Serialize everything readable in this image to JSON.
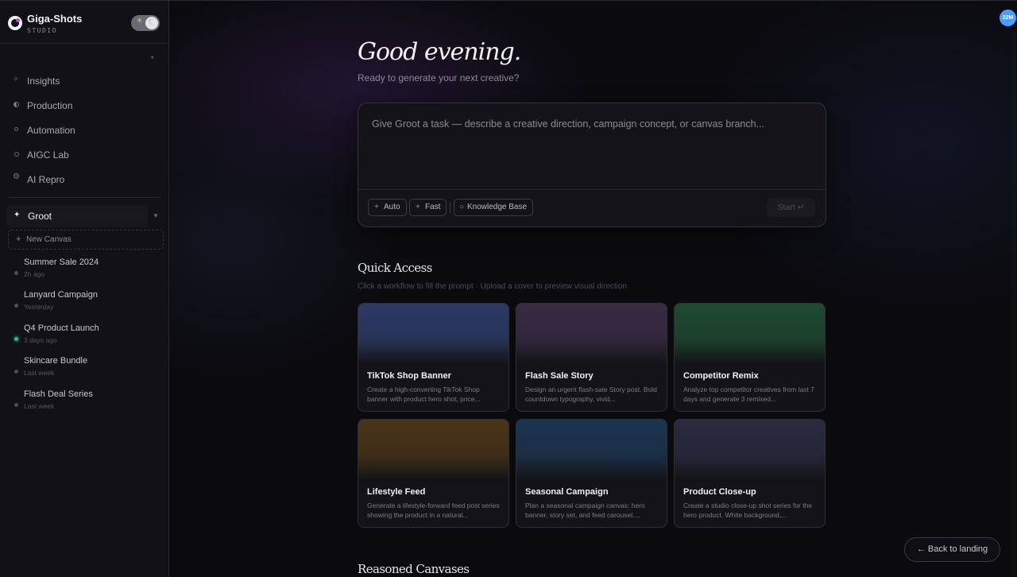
{
  "brand": {
    "name": "Giga-Shots",
    "subtitle": "STUDIO"
  },
  "theme_toggle": {
    "sun_icon": "☀",
    "moon_icon": "☾"
  },
  "sidebar": {
    "collapse_icon": "◂",
    "nav": [
      {
        "label": "Insights",
        "icon": "sparkle-icon"
      },
      {
        "label": "Production",
        "icon": "half-circle-icon"
      },
      {
        "label": "Automation",
        "icon": "circle-icon"
      },
      {
        "label": "AIGC Lab",
        "icon": "circle-icon"
      },
      {
        "label": "AI Repro",
        "icon": "gear-icon"
      }
    ],
    "groot": {
      "label": "Groot",
      "icon": "✦",
      "caret": "▼"
    },
    "new_canvas": {
      "label": "New Canvas",
      "icon": "+"
    },
    "canvases": [
      {
        "title": "Summer Sale 2024",
        "time": "2h ago",
        "active": false
      },
      {
        "title": "Lanyard Campaign",
        "time": "Yesterday",
        "active": false
      },
      {
        "title": "Q4 Product Launch",
        "time": "3 days ago",
        "active": true
      },
      {
        "title": "Skincare Bundle",
        "time": "Last week",
        "active": false
      },
      {
        "title": "Flash Deal Series",
        "time": "Last week",
        "active": false
      }
    ]
  },
  "avatar": {
    "initials": "22M",
    "color": "#4a9eff"
  },
  "greeting": {
    "title": "Good evening.",
    "subtitle": "Ready to generate your next creative?"
  },
  "prompt": {
    "placeholder": "Give Groot a task — describe a creative direction, campaign concept, or canvas branch...",
    "chips": [
      {
        "label": "Auto",
        "icon": "+"
      },
      {
        "label": "Fast",
        "icon": "+"
      },
      {
        "label": "Knowledge Base",
        "icon": "○"
      }
    ],
    "start_label": "Start ↵"
  },
  "quick_access": {
    "title": "Quick Access",
    "subtitle": "Click a workflow to fill the prompt · Upload a cover to preview visual direction",
    "cards": [
      {
        "title": "TikTok Shop Banner",
        "desc": "Create a high-converting TikTok Shop banner with product hero shot, price...",
        "color": "#2c3a66"
      },
      {
        "title": "Flash Sale Story",
        "desc": "Design an urgent flash-sale Story post. Bold countdown typography, vivid...",
        "color": "#3a2a44"
      },
      {
        "title": "Competitor Remix",
        "desc": "Analyze top competitor creatives from last 7 days and generate 3 remixed...",
        "color": "#1e4a30"
      },
      {
        "title": "Lifestyle Feed",
        "desc": "Generate a lifestyle-forward feed post series showing the product in a natural...",
        "color": "#4a3418"
      },
      {
        "title": "Seasonal Campaign",
        "desc": "Plan a seasonal campaign canvas: hero banner, story set, and feed carousel....",
        "color": "#1c3450"
      },
      {
        "title": "Product Close-up",
        "desc": "Create a studio close-up shot series for the hero product. White background,...",
        "color": "#2a2a40"
      }
    ]
  },
  "reasoned_canvases": {
    "title": "Reasoned Canvases"
  },
  "back_button": {
    "label": "← Back to landing"
  }
}
